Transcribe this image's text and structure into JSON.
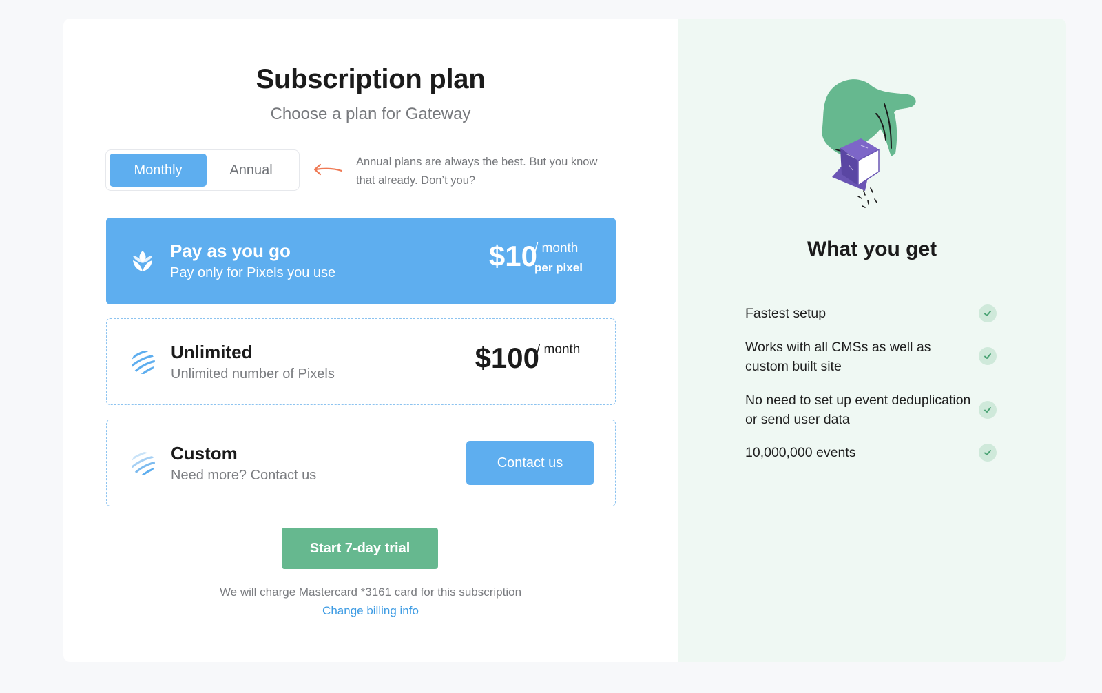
{
  "header": {
    "title": "Subscription plan",
    "subtitle": "Choose a plan for Gateway"
  },
  "billing_toggle": {
    "options": [
      "Monthly",
      "Annual"
    ],
    "selected": "Monthly",
    "hint": "Annual plans are always the best. But you know that already. Don’t you?"
  },
  "plans": [
    {
      "name": "Pay as you go",
      "description": "Pay only for Pixels you use",
      "price": "$10",
      "period": "/ month",
      "unit": "per pixel",
      "selected": true,
      "icon": "leaf-icon"
    },
    {
      "name": "Unlimited",
      "description": "Unlimited number of Pixels",
      "price": "$100",
      "period": "/ month",
      "selected": false,
      "icon": "waves-icon"
    },
    {
      "name": "Custom",
      "description": "Need more? Contact us",
      "button": "Contact us",
      "selected": false,
      "icon": "waves-light-icon"
    }
  ],
  "cta": {
    "trial_button": "Start 7-day trial",
    "charge_note": "We will charge Mastercard *3161 card for this subscription",
    "billing_link": "Change billing info"
  },
  "benefits": {
    "title": "What you get",
    "items": [
      "Fastest setup",
      "Works with all CMSs as well as custom built site",
      "No need to set up event deduplication or send user data",
      "10,000,000 events"
    ]
  },
  "colors": {
    "accent_blue": "#5eaeef",
    "accent_green": "#66b88f",
    "panel_mint": "#eff8f3",
    "link_blue": "#3d9be3",
    "arrow_orange": "#ef7a55"
  }
}
